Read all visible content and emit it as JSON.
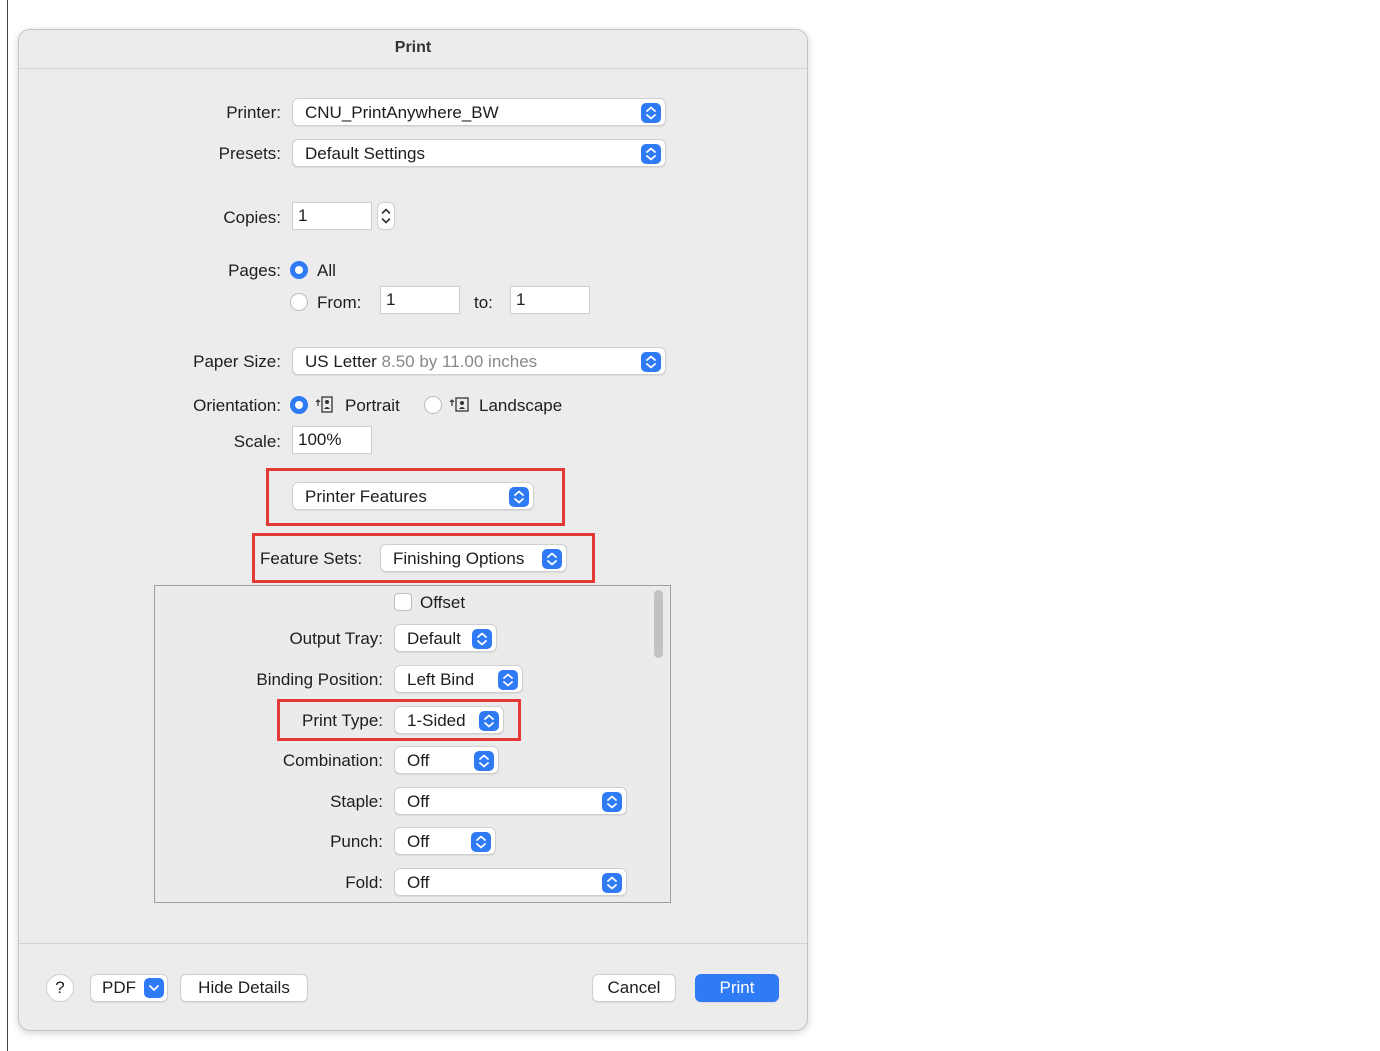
{
  "dialog": {
    "title": "Print"
  },
  "printer": {
    "label": "Printer:",
    "value": "CNU_PrintAnywhere_BW"
  },
  "presets": {
    "label": "Presets:",
    "value": "Default Settings"
  },
  "copies": {
    "label": "Copies:",
    "value": "1"
  },
  "pages": {
    "label": "Pages:",
    "all_label": "All",
    "from_label": "From:",
    "from_value": "1",
    "to_label": "to:",
    "to_value": "1",
    "selected": "All"
  },
  "paper_size": {
    "label": "Paper Size:",
    "value": "US Letter",
    "detail": "8.50 by 11.00 inches"
  },
  "orientation": {
    "label": "Orientation:",
    "portrait_label": "Portrait",
    "landscape_label": "Landscape",
    "selected": "Portrait"
  },
  "scale": {
    "label": "Scale:",
    "value": "100%"
  },
  "section_popup": {
    "value": "Printer Features"
  },
  "feature_sets": {
    "label": "Feature Sets:",
    "value": "Finishing Options"
  },
  "features": {
    "offset": {
      "label": "Offset",
      "checked": false
    },
    "output_tray": {
      "label": "Output Tray:",
      "value": "Default"
    },
    "binding_position": {
      "label": "Binding Position:",
      "value": "Left Bind"
    },
    "print_type": {
      "label": "Print Type:",
      "value": "1-Sided"
    },
    "combination": {
      "label": "Combination:",
      "value": "Off"
    },
    "staple": {
      "label": "Staple:",
      "value": "Off"
    },
    "punch": {
      "label": "Punch:",
      "value": "Off"
    },
    "fold": {
      "label": "Fold:",
      "value": "Off"
    }
  },
  "footer": {
    "help": "?",
    "pdf": "PDF",
    "hide_details": "Hide Details",
    "cancel": "Cancel",
    "print": "Print"
  },
  "colors": {
    "accent": "#2f7bf5",
    "highlight": "#e53935",
    "background": "#ececec"
  }
}
